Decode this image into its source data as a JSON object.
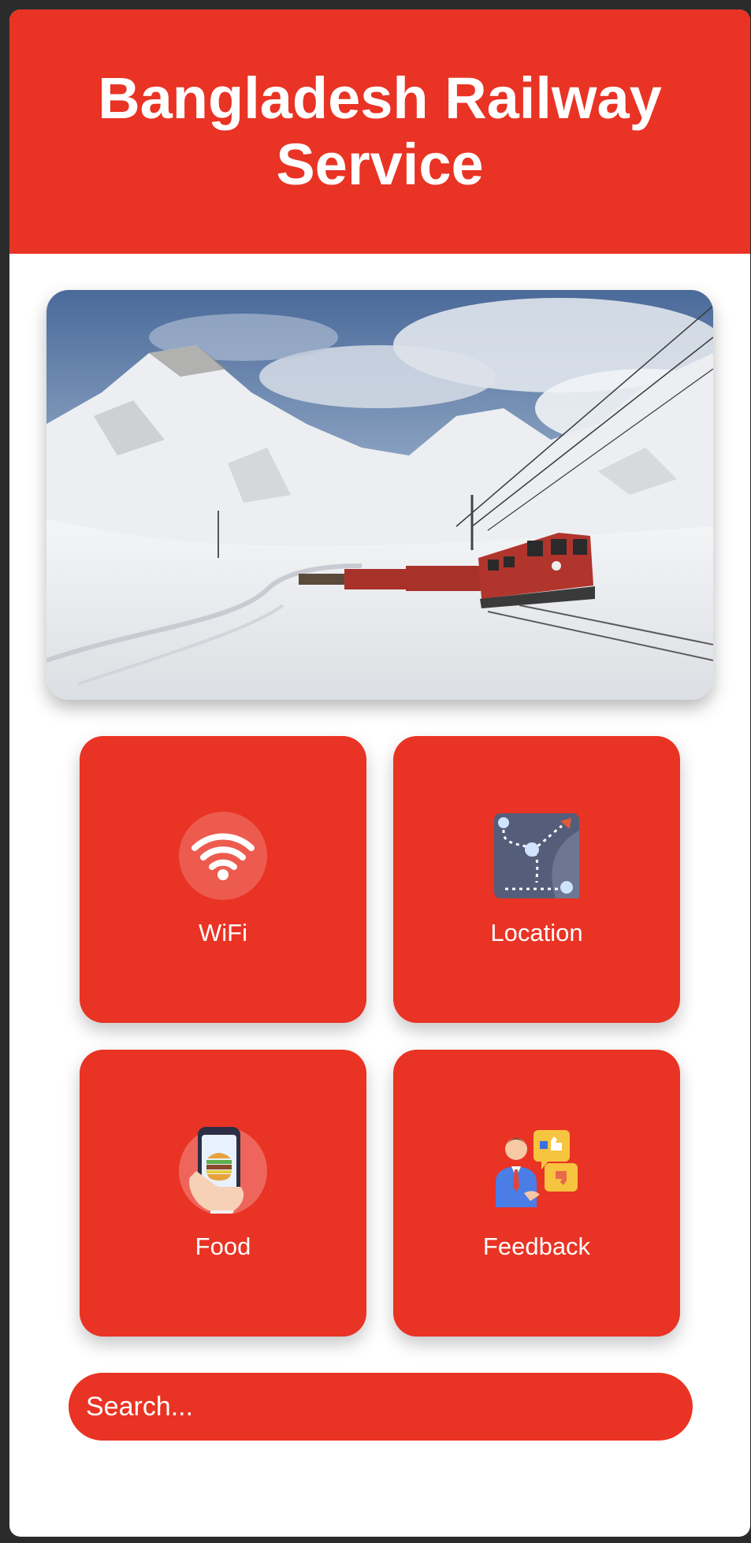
{
  "header": {
    "title": "Bangladesh Railway Service"
  },
  "hero": {
    "image_icon": "snowy-mountain-train-photo"
  },
  "services": [
    {
      "label": "WiFi",
      "icon": "wifi-icon"
    },
    {
      "label": "Location",
      "icon": "map-location-icon"
    },
    {
      "label": "Food",
      "icon": "food-order-phone-icon"
    },
    {
      "label": "Feedback",
      "icon": "feedback-person-icon"
    }
  ],
  "search": {
    "placeholder": "Search..."
  },
  "colors": {
    "accent": "#e93324",
    "background": "#ffffff"
  }
}
